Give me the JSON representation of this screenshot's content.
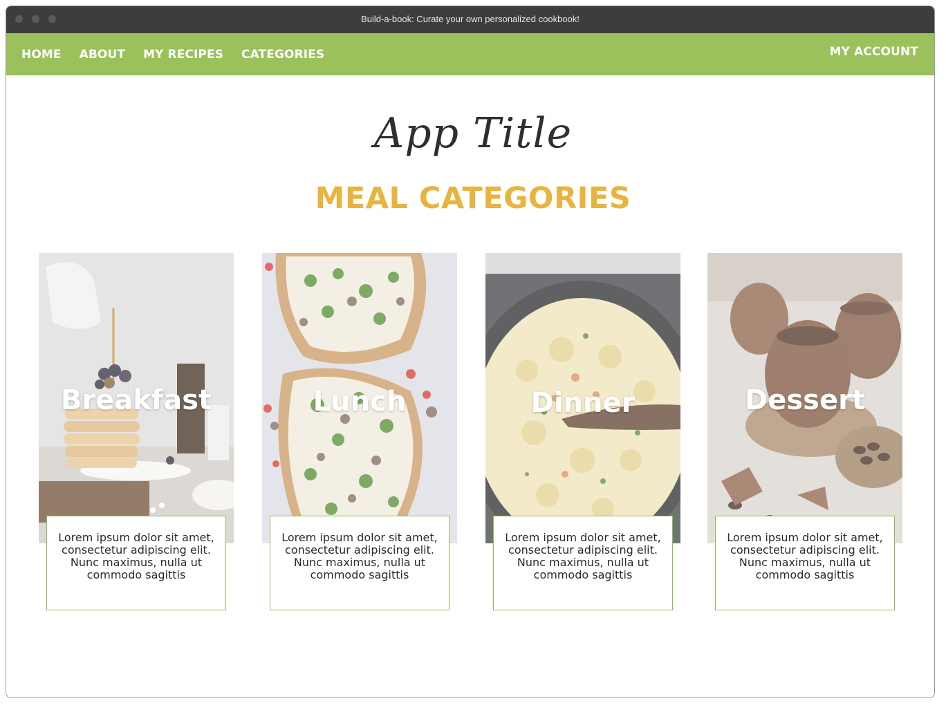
{
  "window": {
    "title": "Build-a-book: Curate your own personalized cookbook!"
  },
  "nav": {
    "items": [
      {
        "label": "HOME"
      },
      {
        "label": "ABOUT"
      },
      {
        "label": "MY RECIPES"
      },
      {
        "label": "CATEGORIES"
      }
    ],
    "account_label": "MY ACCOUNT"
  },
  "header": {
    "app_title": "App Title",
    "section_title": "MEAL CATEGORIES"
  },
  "categories": [
    {
      "name": "Breakfast",
      "description": "Lorem ipsum dolor sit amet, consectetur adipiscing elit. Nunc maximus, nulla ut commodo sagittis",
      "image_icon": "pancakes-photo"
    },
    {
      "name": "Lunch",
      "description": "Lorem ipsum dolor sit amet, consectetur adipiscing elit. Nunc maximus, nulla ut commodo sagittis",
      "image_icon": "flatbread-pizza-photo"
    },
    {
      "name": "Dinner",
      "description": "Lorem ipsum dolor sit amet, consectetur adipiscing elit. Nunc maximus, nulla ut commodo sagittis",
      "image_icon": "pasta-skillet-photo"
    },
    {
      "name": "Dessert",
      "description": "Lorem ipsum dolor sit amet, consectetur adipiscing elit. Nunc maximus, nulla ut commodo sagittis",
      "image_icon": "chocolate-eggs-photo"
    }
  ],
  "colors": {
    "nav_green": "#9ac15b",
    "accent_gold": "#e8b43d",
    "card_border": "#8cbb4f"
  }
}
